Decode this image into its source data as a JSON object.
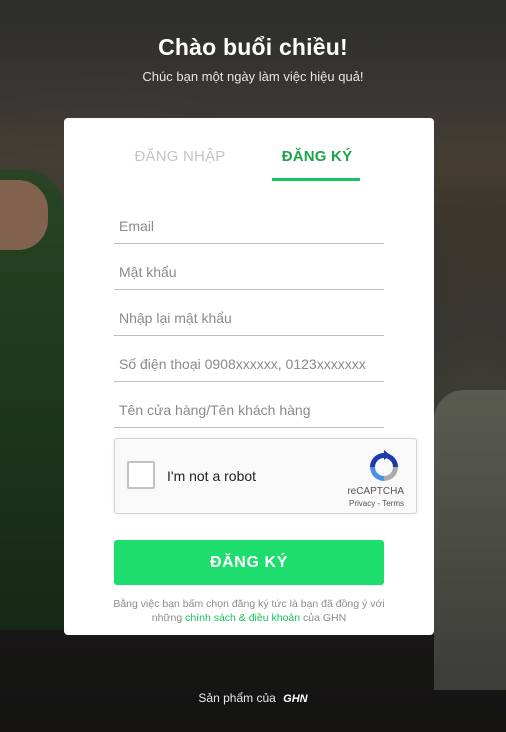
{
  "header": {
    "greeting": "Chào buổi chiều!",
    "subtitle": "Chúc bạn một ngày làm việc hiệu quả!"
  },
  "tabs": {
    "login": "ĐĂNG NHẬP",
    "register": "ĐĂNG KÝ",
    "active": "register"
  },
  "form": {
    "email_placeholder": "Email",
    "password_placeholder": "Mật khẩu",
    "confirm_password_placeholder": "Nhập lại mật khẩu",
    "phone_placeholder": "Số điện thoại 0908xxxxxx, 0123xxxxxxx",
    "shop_name_placeholder": "Tên cửa hàng/Tên khách hàng"
  },
  "recaptcha": {
    "label": "I'm not a robot",
    "brand": "reCAPTCHA",
    "links": "Privacy - Terms"
  },
  "submit_label": "ĐĂNG KÝ",
  "terms": {
    "prefix": "Bằng việc bạn bấm chọn đăng ký tức là bạn đã đồng ý với những",
    "link": "chính sách & điều khoản",
    "suffix": "của GHN"
  },
  "footer": {
    "text": "Sản phẩm của",
    "logo": "GHN"
  },
  "colors": {
    "accent": "#1dde6c",
    "accent_text": "#1ca54a",
    "inactive_tab": "#c4c4c4"
  }
}
